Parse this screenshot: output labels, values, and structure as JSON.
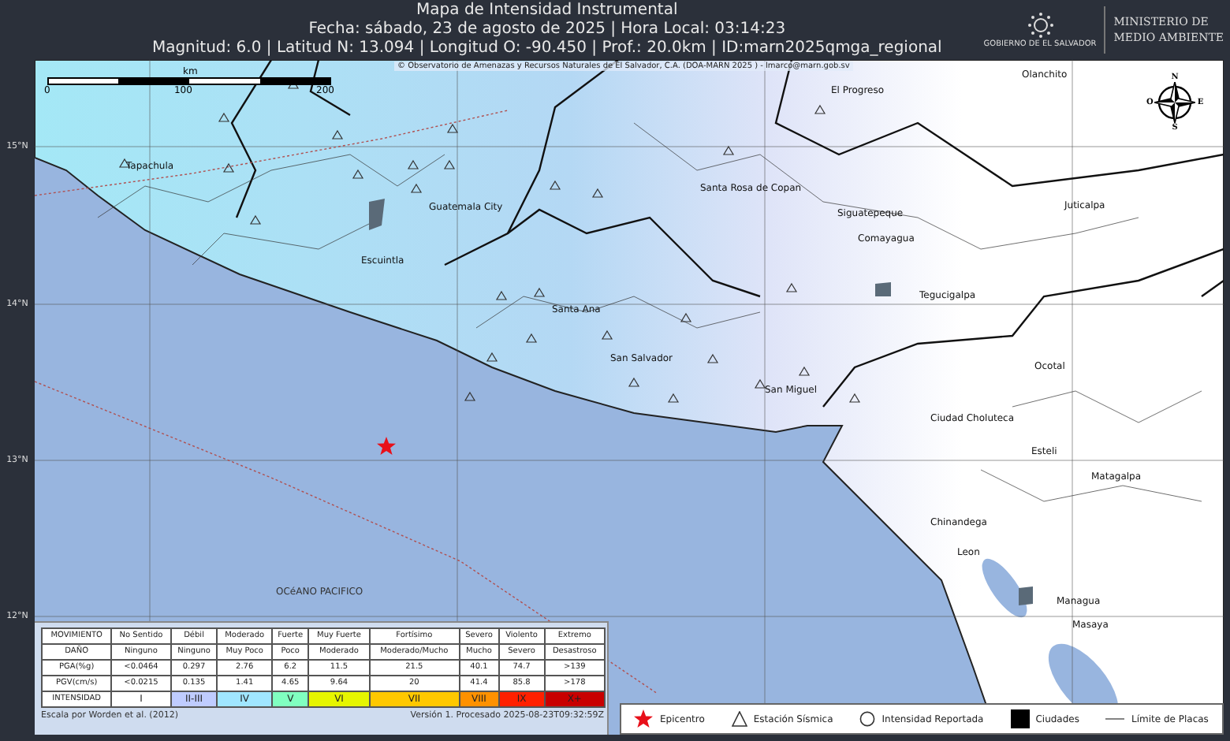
{
  "header": {
    "title": "Mapa de Intensidad Instrumental",
    "date_line": "Fecha: sábado, 23 de agosto de 2025 | Hora Local: 03:14:23",
    "info_line": "Magnitud: 6.0 | Latitud N: 13.094 | Longitud O: -90.450 | Prof.: 20.0km | ID:marn2025qmga_regional"
  },
  "logo": {
    "emblem_caption": "GOBIERNO DE EL SALVADOR",
    "ministry": [
      "MINISTERIO DE",
      "MEDIO AMBIENTE"
    ]
  },
  "map": {
    "credit": "© Observatorio de Amenazas y Recursos Naturales de El Salvador, C.A. (DOA-MARN 2025 ) - lmarco@marn.gob.sv",
    "scale": {
      "unit": "km",
      "ticks": [
        "0",
        "100",
        "200"
      ]
    },
    "compass": {
      "north": "N",
      "west": "O",
      "east": "E",
      "south": "S"
    },
    "latitudes": [
      "15°N",
      "14°N",
      "13°N",
      "12°N"
    ],
    "places": [
      {
        "name": "Olanchito",
        "kind": "city"
      },
      {
        "name": "El Progreso",
        "kind": "city"
      },
      {
        "name": "Tapachula",
        "kind": "city"
      },
      {
        "name": "Guatemala City",
        "kind": "city"
      },
      {
        "name": "Santa Rosa de Copan",
        "kind": "city"
      },
      {
        "name": "Siguatepeque",
        "kind": "city"
      },
      {
        "name": "Juticalpa",
        "kind": "city"
      },
      {
        "name": "Comayagua",
        "kind": "city"
      },
      {
        "name": "Escuintla",
        "kind": "city"
      },
      {
        "name": "Tegucigalpa",
        "kind": "city"
      },
      {
        "name": "Santa Ana",
        "kind": "city"
      },
      {
        "name": "San Salvador",
        "kind": "city"
      },
      {
        "name": "San Miguel",
        "kind": "city"
      },
      {
        "name": "Ocotal",
        "kind": "city"
      },
      {
        "name": "Ciudad Choluteca",
        "kind": "city"
      },
      {
        "name": "Esteli",
        "kind": "city"
      },
      {
        "name": "Matagalpa",
        "kind": "city"
      },
      {
        "name": "Chinandega",
        "kind": "city"
      },
      {
        "name": "Leon",
        "kind": "city"
      },
      {
        "name": "Managua",
        "kind": "city"
      },
      {
        "name": "Masaya",
        "kind": "city"
      },
      {
        "name": "OCéANO PACIFICO",
        "kind": "ocean"
      }
    ]
  },
  "legend_table": {
    "rows": [
      {
        "label": "MOVIMIENTO",
        "cells": [
          "No Sentido",
          "Débil",
          "Moderado",
          "Fuerte",
          "Muy Fuerte",
          "Fortísimo",
          "Severo",
          "Violento",
          "Extremo"
        ]
      },
      {
        "label": "DAÑO",
        "cells": [
          "Ninguno",
          "Ninguno",
          "Muy Poco",
          "Poco",
          "Moderado",
          "Moderado/Mucho",
          "Mucho",
          "Severo",
          "Desastroso"
        ]
      },
      {
        "label": "PGA(%g)",
        "cells": [
          "<0.0464",
          "0.297",
          "2.76",
          "6.2",
          "11.5",
          "21.5",
          "40.1",
          "74.7",
          ">139"
        ]
      },
      {
        "label": "PGV(cm/s)",
        "cells": [
          "<0.0215",
          "0.135",
          "1.41",
          "4.65",
          "9.64",
          "20",
          "41.4",
          "85.8",
          ">178"
        ]
      }
    ],
    "intensity": {
      "label": "INTENSIDAD",
      "levels": [
        {
          "label": "I",
          "color": "#ffffff"
        },
        {
          "label": "II-III",
          "color": "#bfccff"
        },
        {
          "label": "IV",
          "color": "#a0e6ff"
        },
        {
          "label": "V",
          "color": "#80ffc0"
        },
        {
          "label": "VI",
          "color": "#e6f500"
        },
        {
          "label": "VII",
          "color": "#ffc800"
        },
        {
          "label": "VIII",
          "color": "#ff9100"
        },
        {
          "label": "IX",
          "color": "#ff2000"
        },
        {
          "label": "X+",
          "color": "#c80000"
        }
      ]
    },
    "scale_note": "Escala por Worden et al. (2012)",
    "version": "Versión 1. Procesado 2025-08-23T09:32:59Z"
  },
  "symbol_legend": [
    {
      "kind": "epicenter",
      "label": "Epicentro"
    },
    {
      "kind": "station",
      "label": "Estación Sísmica"
    },
    {
      "kind": "reported",
      "label": "Intensidad Reportada"
    },
    {
      "kind": "city",
      "label": "Ciudades"
    },
    {
      "kind": "plate",
      "label": "Límite de Placas"
    }
  ]
}
